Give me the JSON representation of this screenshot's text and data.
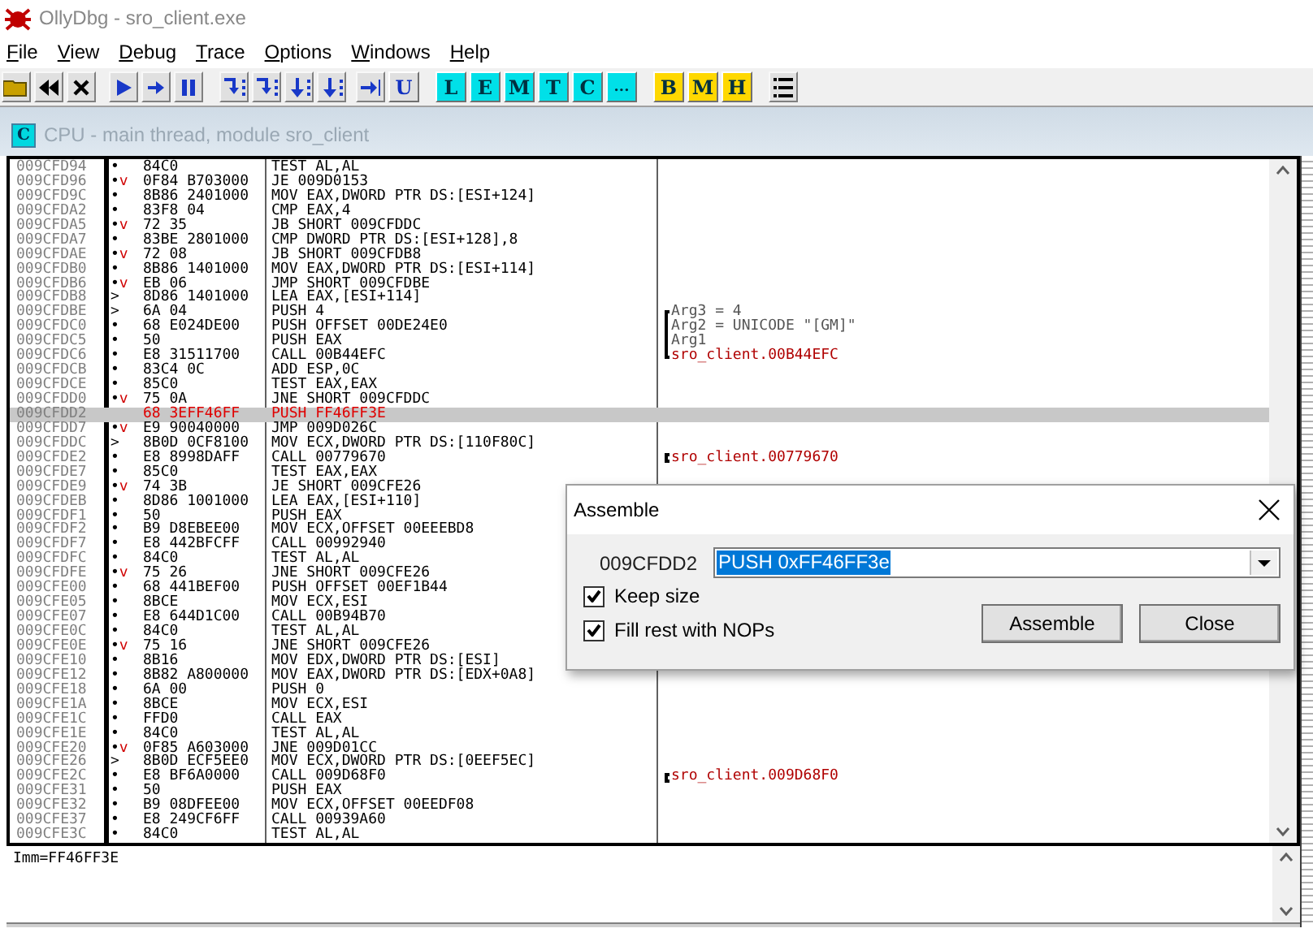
{
  "window": {
    "title": "OllyDbg - sro_client.exe"
  },
  "menu": [
    {
      "label": "File"
    },
    {
      "label": "View"
    },
    {
      "label": "Debug"
    },
    {
      "label": "Trace"
    },
    {
      "label": "Options"
    },
    {
      "label": "Windows"
    },
    {
      "label": "Help"
    }
  ],
  "toolbar": {
    "user_button": "U",
    "window_buttons": [
      {
        "label": "L",
        "color": "#00e0e8"
      },
      {
        "label": "E",
        "color": "#00e0e8"
      },
      {
        "label": "M",
        "color": "#00e0e8"
      },
      {
        "label": "T",
        "color": "#00e0e8"
      },
      {
        "label": "C",
        "color": "#00e0e8"
      },
      {
        "label": "...",
        "color": "#00e0e8"
      },
      {
        "label": "B",
        "color": "#ffd800"
      },
      {
        "label": "M",
        "color": "#ffd800"
      },
      {
        "label": "H",
        "color": "#ffd800"
      }
    ]
  },
  "cpu_window": {
    "icon_label": "C",
    "title": "CPU - main thread, module sro_client"
  },
  "disassembly": {
    "rows": [
      {
        "address": "009CFD94",
        "mark": "•",
        "hex": "84C0",
        "command": "TEST AL,AL",
        "selected": false,
        "modified": false
      },
      {
        "address": "009CFD96",
        "mark": "•",
        "arrow": "v",
        "hex": "0F84 B703000",
        "command": "JE 009D0153",
        "selected": false,
        "modified": false
      },
      {
        "address": "009CFD9C",
        "mark": "•",
        "hex": "8B86 2401000",
        "command": "MOV EAX,DWORD PTR DS:[ESI+124]",
        "selected": false,
        "modified": false
      },
      {
        "address": "009CFDA2",
        "mark": "•",
        "hex": "83F8 04",
        "command": "CMP EAX,4",
        "selected": false,
        "modified": false
      },
      {
        "address": "009CFDA5",
        "mark": "•",
        "arrow": "v",
        "hex": "72 35",
        "command": "JB SHORT 009CFDDC",
        "selected": false,
        "modified": false
      },
      {
        "address": "009CFDA7",
        "mark": "•",
        "hex": "83BE 2801000",
        "command": "CMP DWORD PTR DS:[ESI+128],8",
        "selected": false,
        "modified": false
      },
      {
        "address": "009CFDAE",
        "mark": "•",
        "arrow": "v",
        "hex": "72 08",
        "command": "JB SHORT 009CFDB8",
        "selected": false,
        "modified": false
      },
      {
        "address": "009CFDB0",
        "mark": "•",
        "hex": "8B86 1401000",
        "command": "MOV EAX,DWORD PTR DS:[ESI+114]",
        "selected": false,
        "modified": false
      },
      {
        "address": "009CFDB6",
        "mark": "•",
        "arrow": "v",
        "hex": "EB 06",
        "command": "JMP SHORT 009CFDBE",
        "selected": false,
        "modified": false
      },
      {
        "address": "009CFDB8",
        "mark": ">",
        "hex": "8D86 1401000",
        "command": "LEA EAX,[ESI+114]",
        "selected": false,
        "modified": false
      },
      {
        "address": "009CFDBE",
        "mark": ">",
        "hex": "6A 04",
        "command": "PUSH 4",
        "comment": {
          "kind": "arg_first",
          "text": "Arg3 = 4"
        },
        "selected": false,
        "modified": false
      },
      {
        "address": "009CFDC0",
        "mark": "•",
        "hex": "68 E024DE00",
        "command": "PUSH OFFSET 00DE24E0",
        "comment": {
          "kind": "arg",
          "text": "Arg2 = UNICODE \"[GM]\""
        },
        "selected": false,
        "modified": false
      },
      {
        "address": "009CFDC5",
        "mark": "•",
        "hex": "50",
        "command": "PUSH EAX",
        "comment": {
          "kind": "arg",
          "text": "Arg1"
        },
        "selected": false,
        "modified": false
      },
      {
        "address": "009CFDC6",
        "mark": "•",
        "hex": "E8 31511700",
        "command": "CALL 00B44EFC",
        "comment": {
          "kind": "arg_last",
          "text": "sro_client.00B44EFC"
        },
        "selected": false,
        "modified": false
      },
      {
        "address": "009CFDCB",
        "mark": "•",
        "hex": "83C4 0C",
        "command": "ADD ESP,0C",
        "selected": false,
        "modified": false
      },
      {
        "address": "009CFDCE",
        "mark": "•",
        "hex": "85C0",
        "command": "TEST EAX,EAX",
        "selected": false,
        "modified": false
      },
      {
        "address": "009CFDD0",
        "mark": "•",
        "arrow": "v",
        "hex": "75 0A",
        "command": "JNE SHORT 009CFDDC",
        "selected": false,
        "modified": false
      },
      {
        "address": "009CFDD2",
        "hex": "68 3EFF46FF",
        "command": "PUSH FF46FF3E",
        "selected": true,
        "modified": true
      },
      {
        "address": "009CFDD7",
        "mark": "•",
        "arrow": "v",
        "hex": "E9 90040000",
        "command": "JMP 009D026C",
        "selected": false,
        "modified": false
      },
      {
        "address": "009CFDDC",
        "mark": ">",
        "hex": "8B0D 0CF8100",
        "command": "MOV ECX,DWORD PTR DS:[110F80C]",
        "selected": false,
        "modified": false
      },
      {
        "address": "009CFDE2",
        "mark": "•",
        "hex": "E8 8998DAFF",
        "command": "CALL 00779670",
        "comment": {
          "kind": "call",
          "text": "sro_client.00779670"
        },
        "selected": false,
        "modified": false
      },
      {
        "address": "009CFDE7",
        "mark": "•",
        "hex": "85C0",
        "command": "TEST EAX,EAX",
        "selected": false,
        "modified": false
      },
      {
        "address": "009CFDE9",
        "mark": "•",
        "arrow": "v",
        "hex": "74 3B",
        "command": "JE SHORT 009CFE26",
        "selected": false,
        "modified": false
      },
      {
        "address": "009CFDEB",
        "mark": "•",
        "hex": "8D86 1001000",
        "command": "LEA EAX,[ESI+110]",
        "selected": false,
        "modified": false
      },
      {
        "address": "009CFDF1",
        "mark": "•",
        "hex": "50",
        "command": "PUSH EAX",
        "selected": false,
        "modified": false
      },
      {
        "address": "009CFDF2",
        "mark": "•",
        "hex": "B9 D8EBEE00",
        "command": "MOV ECX,OFFSET 00EEEBD8",
        "selected": false,
        "modified": false
      },
      {
        "address": "009CFDF7",
        "mark": "•",
        "hex": "E8 442BFCFF",
        "command": "CALL 00992940",
        "selected": false,
        "modified": false
      },
      {
        "address": "009CFDFC",
        "mark": "•",
        "hex": "84C0",
        "command": "TEST AL,AL",
        "selected": false,
        "modified": false
      },
      {
        "address": "009CFDFE",
        "mark": "•",
        "arrow": "v",
        "hex": "75 26",
        "command": "JNE SHORT 009CFE26",
        "selected": false,
        "modified": false
      },
      {
        "address": "009CFE00",
        "mark": "•",
        "hex": "68 441BEF00",
        "command": "PUSH OFFSET 00EF1B44",
        "selected": false,
        "modified": false
      },
      {
        "address": "009CFE05",
        "mark": "•",
        "hex": "8BCE",
        "command": "MOV ECX,ESI",
        "selected": false,
        "modified": false
      },
      {
        "address": "009CFE07",
        "mark": "•",
        "hex": "E8 644D1C00",
        "command": "CALL 00B94B70",
        "selected": false,
        "modified": false
      },
      {
        "address": "009CFE0C",
        "mark": "•",
        "hex": "84C0",
        "command": "TEST AL,AL",
        "selected": false,
        "modified": false
      },
      {
        "address": "009CFE0E",
        "mark": "•",
        "arrow": "v",
        "hex": "75 16",
        "command": "JNE SHORT 009CFE26",
        "selected": false,
        "modified": false
      },
      {
        "address": "009CFE10",
        "mark": "•",
        "hex": "8B16",
        "command": "MOV EDX,DWORD PTR DS:[ESI]",
        "selected": false,
        "modified": false
      },
      {
        "address": "009CFE12",
        "mark": "•",
        "hex": "8B82 A800000",
        "command": "MOV EAX,DWORD PTR DS:[EDX+0A8]",
        "selected": false,
        "modified": false
      },
      {
        "address": "009CFE18",
        "mark": "•",
        "hex": "6A 00",
        "command": "PUSH 0",
        "selected": false,
        "modified": false
      },
      {
        "address": "009CFE1A",
        "mark": "•",
        "hex": "8BCE",
        "command": "MOV ECX,ESI",
        "selected": false,
        "modified": false
      },
      {
        "address": "009CFE1C",
        "mark": "•",
        "hex": "FFD0",
        "command": "CALL EAX",
        "selected": false,
        "modified": false
      },
      {
        "address": "009CFE1E",
        "mark": "•",
        "hex": "84C0",
        "command": "TEST AL,AL",
        "selected": false,
        "modified": false
      },
      {
        "address": "009CFE20",
        "mark": "•",
        "arrow": "v",
        "hex": "0F85 A603000",
        "command": "JNE 009D01CC",
        "selected": false,
        "modified": false
      },
      {
        "address": "009CFE26",
        "mark": ">",
        "hex": "8B0D ECF5EE0",
        "command": "MOV ECX,DWORD PTR DS:[0EEF5EC]",
        "selected": false,
        "modified": false
      },
      {
        "address": "009CFE2C",
        "mark": "•",
        "hex": "E8 BF6A0000",
        "command": "CALL 009D68F0",
        "comment": {
          "kind": "call",
          "text": "sro_client.009D68F0"
        },
        "selected": false,
        "modified": false
      },
      {
        "address": "009CFE31",
        "mark": "•",
        "hex": "50",
        "command": "PUSH EAX",
        "selected": false,
        "modified": false
      },
      {
        "address": "009CFE32",
        "mark": "•",
        "hex": "B9 08DFEE00",
        "command": "MOV ECX,OFFSET 00EEDF08",
        "selected": false,
        "modified": false
      },
      {
        "address": "009CFE37",
        "mark": "•",
        "hex": "E8 249CF6FF",
        "command": "CALL 00939A60",
        "selected": false,
        "modified": false
      },
      {
        "address": "009CFE3C",
        "mark": "•",
        "hex": "84C0",
        "command": "TEST AL,AL",
        "selected": false,
        "modified": false
      }
    ]
  },
  "info": {
    "text": "Imm=FF46FF3E"
  },
  "dialog": {
    "title": "Assemble",
    "address": "009CFDD2",
    "value": "PUSH 0xFF46FF3e",
    "options": [
      {
        "label": "Keep size",
        "checked": true
      },
      {
        "label": "Fill rest with NOPs",
        "checked": true
      }
    ],
    "buttons": [
      "Assemble",
      "Close"
    ]
  }
}
